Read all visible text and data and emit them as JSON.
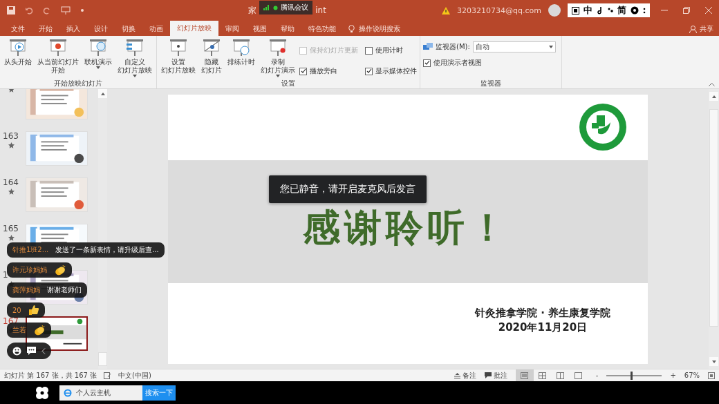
{
  "title_bar": {
    "title_start": "家",
    "title_end": "int",
    "meeting_widget": "腾讯会议",
    "account": "3203210734@qq.com",
    "ime": [
      "中",
      "简"
    ]
  },
  "tabs": [
    {
      "label": "文件",
      "selected": false
    },
    {
      "label": "开始",
      "selected": false
    },
    {
      "label": "插入",
      "selected": false
    },
    {
      "label": "设计",
      "selected": false
    },
    {
      "label": "切换",
      "selected": false
    },
    {
      "label": "动画",
      "selected": false
    },
    {
      "label": "幻灯片放映",
      "selected": true
    },
    {
      "label": "审阅",
      "selected": false
    },
    {
      "label": "视图",
      "selected": false
    },
    {
      "label": "帮助",
      "selected": false
    },
    {
      "label": "特色功能",
      "selected": false
    }
  ],
  "tell_me": "操作说明搜索",
  "share": "共享",
  "ribbon": {
    "groups": [
      {
        "title": "开始放映幻灯片",
        "buttons": [
          {
            "lines": [
              "从头开始"
            ],
            "dropdown": false
          },
          {
            "lines": [
              "从当前幻灯片",
              "开始"
            ],
            "dropdown": false
          },
          {
            "lines": [
              "联机演示"
            ],
            "dropdown": true
          },
          {
            "lines": [
              "自定义",
              "幻灯片放映"
            ],
            "dropdown": true
          }
        ]
      },
      {
        "title": "设置",
        "buttons": [
          {
            "lines": [
              "设置",
              "幻灯片放映"
            ],
            "dropdown": false
          },
          {
            "lines": [
              "隐藏",
              "幻灯片"
            ],
            "dropdown": false
          },
          {
            "lines": [
              "排练计时"
            ],
            "dropdown": false
          },
          {
            "lines": [
              "录制",
              "幻灯片演示"
            ],
            "dropdown": true
          }
        ],
        "checkboxes": [
          {
            "label": "保持幻灯片更新",
            "checked": false,
            "disabled": true
          },
          {
            "label": "播放旁白",
            "checked": true,
            "disabled": false
          },
          {
            "label": "使用计时",
            "checked": false,
            "disabled": false
          },
          {
            "label": "显示媒体控件",
            "checked": true,
            "disabled": false
          }
        ]
      },
      {
        "title": "监视器",
        "monitor": {
          "label": "监视器(M):",
          "value": "自动"
        },
        "checkboxes": [
          {
            "label": "使用演示者视图",
            "checked": true,
            "disabled": false
          }
        ]
      }
    ]
  },
  "thumbnails": [
    {
      "selected": false
    },
    {
      "number": "163",
      "selected": false
    },
    {
      "number": "164",
      "selected": false
    },
    {
      "number": "165",
      "selected": false
    },
    {
      "number": "1",
      "selected": false
    },
    {
      "number": "167",
      "selected": true
    }
  ],
  "slide": {
    "title": "感谢聆听！",
    "institution": "针灸推拿学院 · 养生康复学院",
    "date": "2020年11月20日"
  },
  "toast": "您已静音，请开启麦克风后发言",
  "chat": [
    {
      "kind": "text",
      "name": "针推1班2...",
      "message": "发送了一条新表情，请升级后查..."
    },
    {
      "kind": "clap",
      "name": "许元珍妈妈"
    },
    {
      "kind": "text",
      "name": "龚萍妈妈",
      "message": "谢谢老师们"
    },
    {
      "kind": "thumbs",
      "name": "20"
    },
    {
      "kind": "clap",
      "name": "兰若"
    }
  ],
  "status_bar": {
    "slide_info": "幻灯片 第 167 张，共 167 张",
    "language": "中文(中国)",
    "notes": "备注",
    "comments": "批注",
    "views": [
      {
        "selected": true
      },
      {
        "selected": false
      },
      {
        "selected": false
      },
      {
        "selected": false
      }
    ],
    "zoom_minus": "-",
    "zoom_plus": "+",
    "zoom": {
      "level": 0.45
    },
    "zoom_reading": "67%"
  },
  "taskbar": {
    "search_value": "个人云主机",
    "search_button": "搜索一下"
  }
}
